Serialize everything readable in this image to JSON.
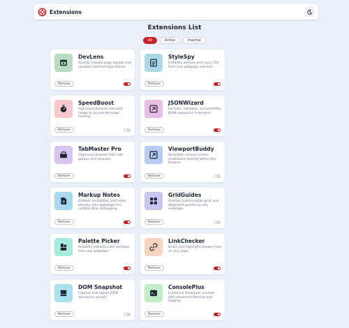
{
  "header": {
    "brand": "Extensions"
  },
  "page_title": "Extensions List",
  "filters": [
    {
      "label": "All",
      "active": true
    },
    {
      "label": "Active",
      "active": false
    },
    {
      "label": "Inactive",
      "active": false
    }
  ],
  "accent_color": "#c8232b",
  "remove_label": "Remove",
  "extensions": [
    {
      "name": "DevLens",
      "description": "Quickly inspect page layouts and visualize element boundaries.",
      "enabled": true,
      "icon": "devlens-icon",
      "icon_bg": "#b9dbc0"
    },
    {
      "name": "StyleSpy",
      "description": "Instantly analyze and copy CSS from any webpage element.",
      "enabled": true,
      "icon": "stylespy-icon",
      "icon_bg": "#a9d9e8"
    },
    {
      "name": "SpeedBoost",
      "description": "Optimizes browser resource usage to accelerate page loading.",
      "enabled": false,
      "icon": "speedboost-icon",
      "icon_bg": "#f7c9cc"
    },
    {
      "name": "JSONWizard",
      "description": "Formats, validates, and prettifies JSON responses in-browser.",
      "enabled": true,
      "icon": "jsonwizard-icon",
      "icon_bg": "#e8bde6"
    },
    {
      "name": "TabMaster Pro",
      "description": "Organizes browser tabs into groups and sessions.",
      "enabled": true,
      "icon": "tabmaster-icon",
      "icon_bg": "#d6c6ef"
    },
    {
      "name": "ViewportBuddy",
      "description": "Simulates various screen resolutions directly within the browser.",
      "enabled": false,
      "icon": "viewportbuddy-icon",
      "icon_bg": "#b5cdf2"
    },
    {
      "name": "Markup Notes",
      "description": "Enables annotation and notes directly onto webpages for collaborative debugging.",
      "enabled": true,
      "icon": "markupnotes-icon",
      "icon_bg": "#a9d9ee"
    },
    {
      "name": "GridGuides",
      "description": "Overlay customizable grids and alignment guides on any webpage.",
      "enabled": false,
      "icon": "gridguides-icon",
      "icon_bg": "#c7c5f2"
    },
    {
      "name": "Palette Picker",
      "description": "Instantly extracts color palettes from any webpage.",
      "enabled": true,
      "icon": "palettepicker-icon",
      "icon_bg": "#a6ecde"
    },
    {
      "name": "LinkChecker",
      "description": "Scans and highlights broken links on any page.",
      "enabled": true,
      "icon": "linkchecker-icon",
      "icon_bg": "#f8d3bf"
    },
    {
      "name": "DOM Snapshot",
      "description": "Capture and export DOM structures quickly.",
      "enabled": false,
      "icon": "domsnapshot-icon",
      "icon_bg": "#a9e2ee"
    },
    {
      "name": "ConsolePlus",
      "description": "Enhanced developer console with advanced filtering and logging.",
      "enabled": true,
      "icon": "consoleplus-icon",
      "icon_bg": "#c2ecc6"
    }
  ]
}
